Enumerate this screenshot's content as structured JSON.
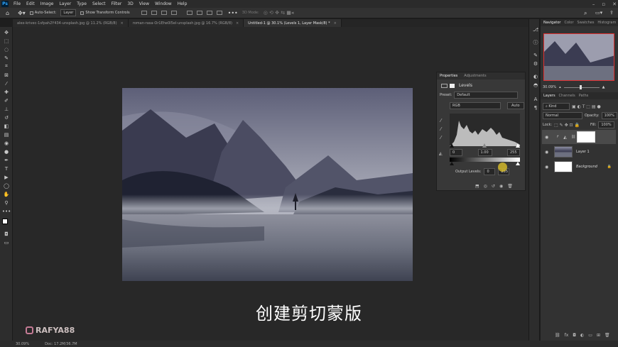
{
  "app": {
    "logo": "Ps"
  },
  "menu": [
    "File",
    "Edit",
    "Image",
    "Layer",
    "Type",
    "Select",
    "Filter",
    "3D",
    "View",
    "Window",
    "Help"
  ],
  "options_bar": {
    "auto_select_label": "Auto-Select:",
    "auto_select_value": "Layer",
    "show_transform_label": "Show Transform Controls",
    "mode_3d_label": "3D Mode:"
  },
  "tabs": [
    {
      "label": "alex-krivec-1sfpah2Y434-unsplash.jpg @ 11.2% (RGB/8)",
      "close": "×"
    },
    {
      "label": "roman-rasa-Or1Ehe0I5el-unsplash.jpg @ 16.7% (RGB/8)",
      "close": "×"
    },
    {
      "label": "Untitled-1 @ 30.1% (Levels 1, Layer Mask/8) *",
      "close": "×"
    }
  ],
  "caption": "创建剪切蒙版",
  "watermark": "RAFYA88",
  "properties": {
    "tab_properties": "Properties",
    "tab_adjustments": "Adjustments",
    "title": "Levels",
    "preset_label": "Preset:",
    "preset_value": "Default",
    "channel": "RGB",
    "auto_button": "Auto",
    "input_black": "0",
    "input_gamma": "1.00",
    "input_white": "255",
    "output_label": "Output Levels:",
    "output_black": "0",
    "output_white": "255"
  },
  "navigator": {
    "tabs": [
      "Navigator",
      "Color",
      "Swatches",
      "Histogram"
    ],
    "zoom": "30.09%"
  },
  "layers": {
    "tabs": [
      "Layers",
      "Channels",
      "Paths"
    ],
    "filter_kind": "Kind",
    "blend_mode": "Normal",
    "opacity_label": "Opacity:",
    "opacity_value": "100%",
    "lock_label": "Lock:",
    "fill_label": "Fill:",
    "fill_value": "100%",
    "items": [
      {
        "name": "",
        "type": "levels"
      },
      {
        "name": "Layer 1",
        "type": "image"
      },
      {
        "name": "Background",
        "type": "white"
      }
    ]
  },
  "status": {
    "zoom": "30.09%",
    "doc": "Doc: 17.2M/36.7M"
  },
  "colors": {
    "accent": "#31a8ff",
    "panel": "#383838"
  }
}
